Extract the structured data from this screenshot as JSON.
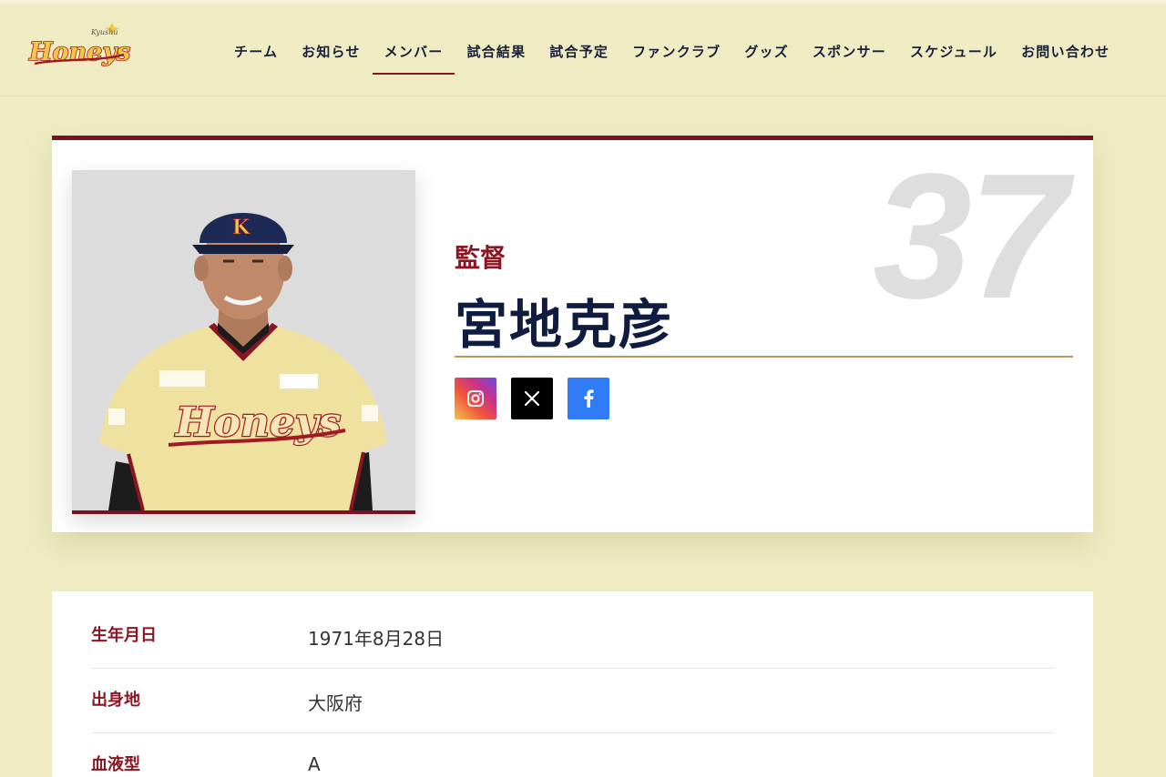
{
  "header": {
    "logo_text": "Honeys",
    "logo_script": "Kyushu"
  },
  "nav": {
    "items": [
      {
        "label": "チーム"
      },
      {
        "label": "お知らせ"
      },
      {
        "label": "メンバー"
      },
      {
        "label": "試合結果"
      },
      {
        "label": "試合予定"
      },
      {
        "label": "ファンクラブ"
      },
      {
        "label": "グッズ"
      },
      {
        "label": "スポンサー"
      },
      {
        "label": "スケジュール"
      },
      {
        "label": "お問い合わせ"
      }
    ],
    "active_item": "メンバー"
  },
  "profile": {
    "role": "監督",
    "name": "宮地克彦",
    "number": "37",
    "uniform_text": "Honeys",
    "socials": [
      "instagram-icon",
      "x-icon",
      "facebook-icon"
    ]
  },
  "details": [
    {
      "label": "生年月日",
      "value": "1971年8月28日"
    },
    {
      "label": "出身地",
      "value": "大阪府"
    },
    {
      "label": "血液型",
      "value": "A"
    }
  ],
  "colors": {
    "background": "#efecc4",
    "accent_maroon": "#7a1020",
    "navy": "#0f1c3f",
    "gold": "#b9985a",
    "facebook": "#2f7cf6"
  }
}
